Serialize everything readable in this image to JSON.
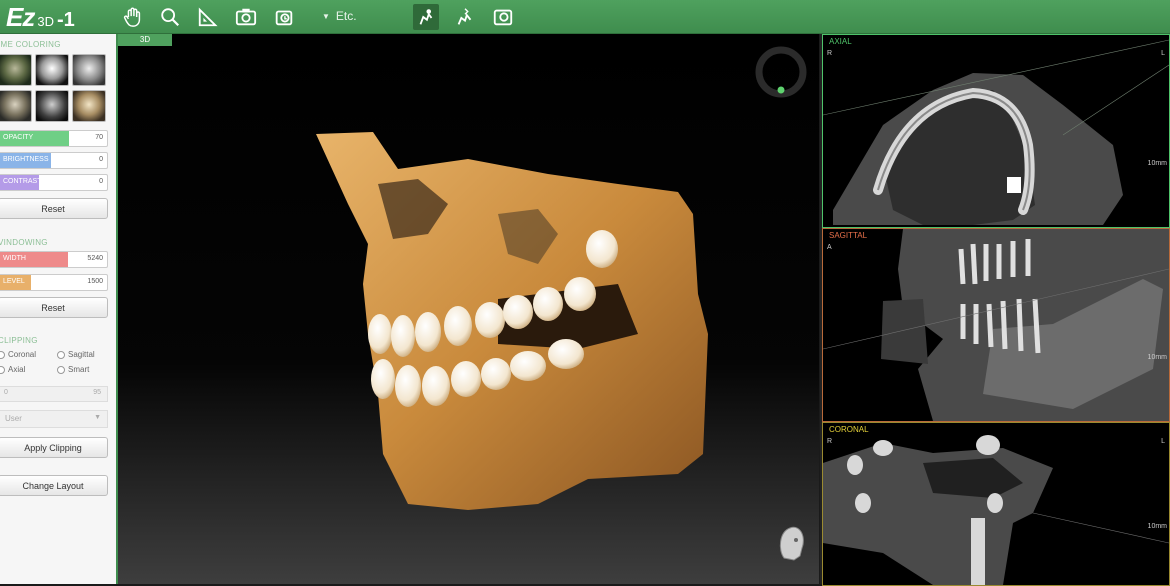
{
  "app": {
    "logo_main": "Ez",
    "logo_sub": "3D",
    "logo_suffix": "-1"
  },
  "toolbar": {
    "icons": [
      "hand-pan-icon",
      "zoom-magnifier-icon",
      "ruler-triangle-icon",
      "camera-capture-icon",
      "export-icon",
      "skull-view-icon",
      "skull-side-icon",
      "image-export-icon"
    ],
    "etc_label": "Etc."
  },
  "sidebar": {
    "volume_coloring_title": "IME COLORING",
    "opacity": {
      "label": "OPACITY",
      "value": "70",
      "level": 0.7
    },
    "brightness": {
      "label": "BRIGHTNESS",
      "value": "0",
      "level": 0.5
    },
    "contrast": {
      "label": "CONTRAST",
      "value": "0",
      "level": 0.5
    },
    "reset_label": "Reset",
    "windowing_title": "VINDOWING",
    "width": {
      "label": "WIDTH",
      "value": "5240",
      "level": 0.65
    },
    "level": {
      "label": "LEVEL",
      "value": "1500",
      "level": 0.3
    },
    "reset2_label": "Reset",
    "clipping_title": "CLIPPING",
    "radios": {
      "coronal": "Coronal",
      "sagittal": "Sagittal",
      "axial": "Axial",
      "smart": "Smart"
    },
    "clip_value_left": "0",
    "clip_value_right": "95",
    "user_select": "User",
    "apply_clipping_label": "Apply Clipping",
    "change_layout_label": "Change Layout"
  },
  "views": {
    "main_tab": "3D",
    "axial": {
      "label": "AXIAL",
      "left": "R",
      "right": "L",
      "color": "#4fc36a"
    },
    "sagittal": {
      "label": "SAGITTAL",
      "left": "A",
      "right": "P",
      "color": "#e8704a"
    },
    "coronal": {
      "label": "CORONAL",
      "left": "R",
      "right": "L",
      "color": "#e6d23a"
    },
    "scale_label": "10mm"
  }
}
